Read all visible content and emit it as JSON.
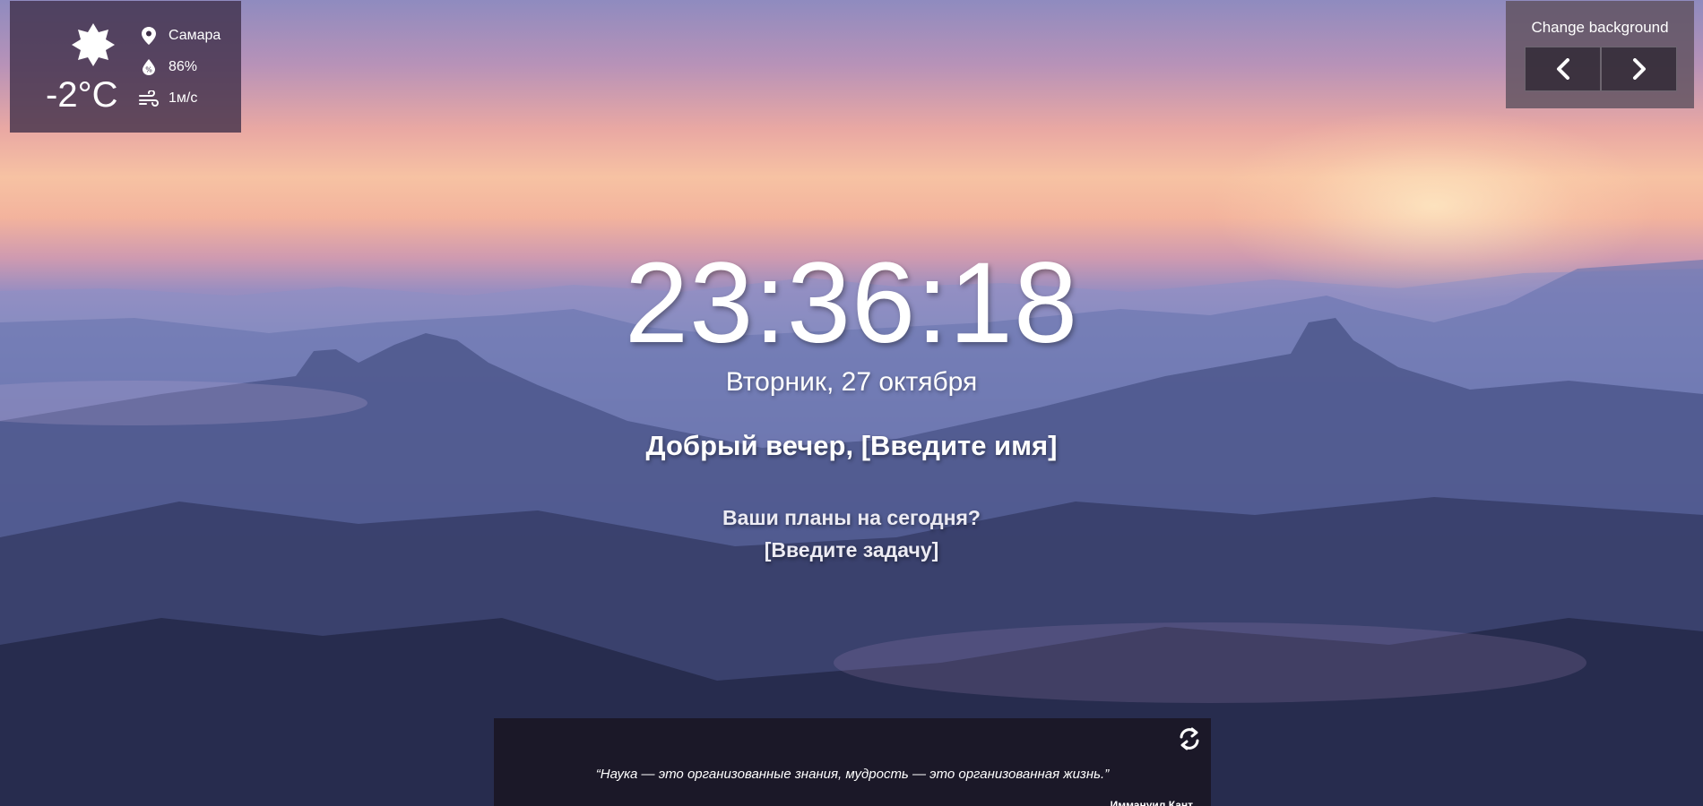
{
  "weather": {
    "icon": "sun-icon",
    "temperature": "-2°C",
    "city": "Самара",
    "humidity": "86%",
    "wind": "1м/с"
  },
  "background_switcher": {
    "title": "Change background",
    "prev_icon": "chevron-left-icon",
    "next_icon": "chevron-right-icon"
  },
  "clock": {
    "time": "23:36:18",
    "date": "Вторник, 27 октября"
  },
  "greeting": {
    "text": "Добрый вечер, ",
    "name_placeholder": "[Введите имя]"
  },
  "focus": {
    "question": "Ваши планы на сегодня?",
    "task_placeholder": "[Введите задачу]"
  },
  "quote": {
    "text": "“Наука — это организованные знания, мудрость — это организованная жизнь.”",
    "author": "Иммануил Кант",
    "refresh_icon": "refresh-icon"
  }
}
